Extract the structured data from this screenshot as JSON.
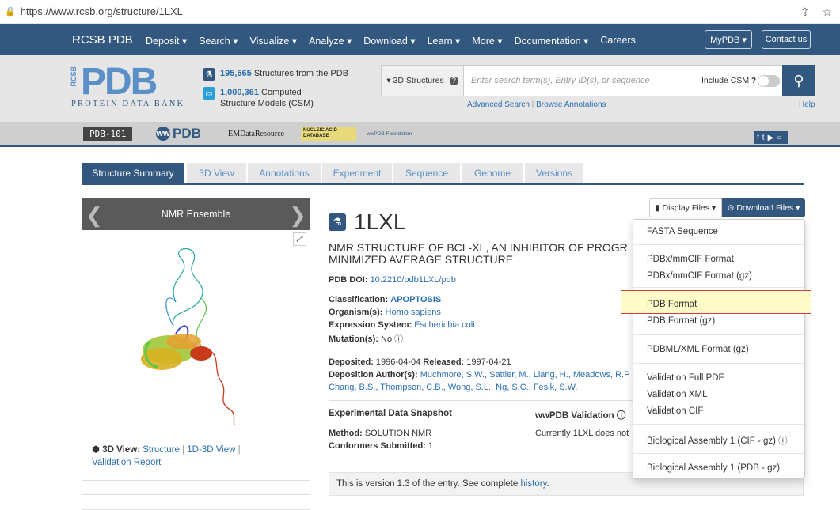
{
  "browser": {
    "url": "https://www.rcsb.org/structure/1LXL"
  },
  "nav": {
    "brand": "RCSB PDB",
    "menu": [
      "Deposit ▾",
      "Search ▾",
      "Visualize ▾",
      "Analyze ▾",
      "Download ▾",
      "Learn ▾",
      "More ▾",
      "Documentation ▾",
      "Careers"
    ],
    "mypdb": "MyPDB ▾",
    "contact": "Contact us"
  },
  "header": {
    "logo_letters": "PDB",
    "logo_side": "RCSB",
    "logo_sub": "PROTEIN DATA BANK",
    "stat1_num": "195,565",
    "stat1_text": "Structures from the PDB",
    "stat2_num": "1,000,361",
    "stat2_text": "Computed Structure Models (CSM)"
  },
  "search": {
    "dropdown": "▾ 3D Structures",
    "placeholder": "Enter search term(s), Entry ID(s), or sequence",
    "include_csm": "Include CSM",
    "advanced": "Advanced Search",
    "browse": "Browse Annotations",
    "help": "Help"
  },
  "partners": [
    "PDB-101",
    "PDB",
    "EMDataResource",
    "NUCLEIC ACID DATABASE",
    "wwPDB Foundation"
  ],
  "tabs": [
    "Structure Summary",
    "3D View",
    "Annotations",
    "Experiment",
    "Sequence",
    "Genome",
    "Versions"
  ],
  "left": {
    "ensemble_title": "NMR Ensemble",
    "view3d_label": "3D View:",
    "view3d_structure": "Structure",
    "view3d_1d3d": "1D-3D View",
    "view3d_validation": "Validation Report"
  },
  "entry": {
    "id": "1LXL",
    "description_line1": "NMR STRUCTURE OF BCL-XL, AN INHIBITOR OF PROGR",
    "description_line2": "MINIMIZED AVERAGE STRUCTURE",
    "doi_label": "PDB DOI:",
    "doi": "10.2210/pdb1LXL/pdb",
    "classification_label": "Classification:",
    "classification": "APOPTOSIS",
    "organism_label": "Organism(s):",
    "organism": "Homo sapiens",
    "expression_label": "Expression System:",
    "expression": "Escherichia coli",
    "mutation_label": "Mutation(s):",
    "mutation": "No",
    "deposited_label": "Deposited:",
    "deposited": "1996-04-04",
    "released_label": "Released:",
    "released": "1997-04-21",
    "authors_label": "Deposition Author(s):",
    "authors_line1": "Muchmore, S.W., Sattler, M., Liang, H., Meadows, R.P",
    "authors_line2": "Chang, B.S., Thompson, C.B., Wong, S.L., Ng, S.C., Fesik, S.W.",
    "snapshot_title": "Experimental Data Snapshot",
    "method_label": "Method:",
    "method": "SOLUTION NMR",
    "conformers_label": "Conformers Submitted:",
    "conformers": "1",
    "validation_title": "wwPDB Validation",
    "validation_text": "Currently 1LXL does not",
    "version_text": "This is version 1.3 of the entry. See complete",
    "version_link": "history",
    "version_end": "."
  },
  "buttons": {
    "display_files": "Display Files ▾",
    "download_files": "Download Files ▾"
  },
  "download_menu": [
    "FASTA Sequence",
    "PDBx/mmCIF Format",
    "PDBx/mmCIF Format (gz)",
    "PDB Format",
    "PDB Format (gz)",
    "PDBML/XML Format (gz)",
    "Validation Full PDF",
    "Validation XML",
    "Validation CIF",
    "Biological Assembly 1 (CIF - gz)",
    "Biological Assembly 1 (PDB - gz)"
  ],
  "colors": {
    "nav": "#325880",
    "accent": "#2a6fb0",
    "highlight": "#fdfbc8",
    "highlight_border": "#d23c3c"
  }
}
